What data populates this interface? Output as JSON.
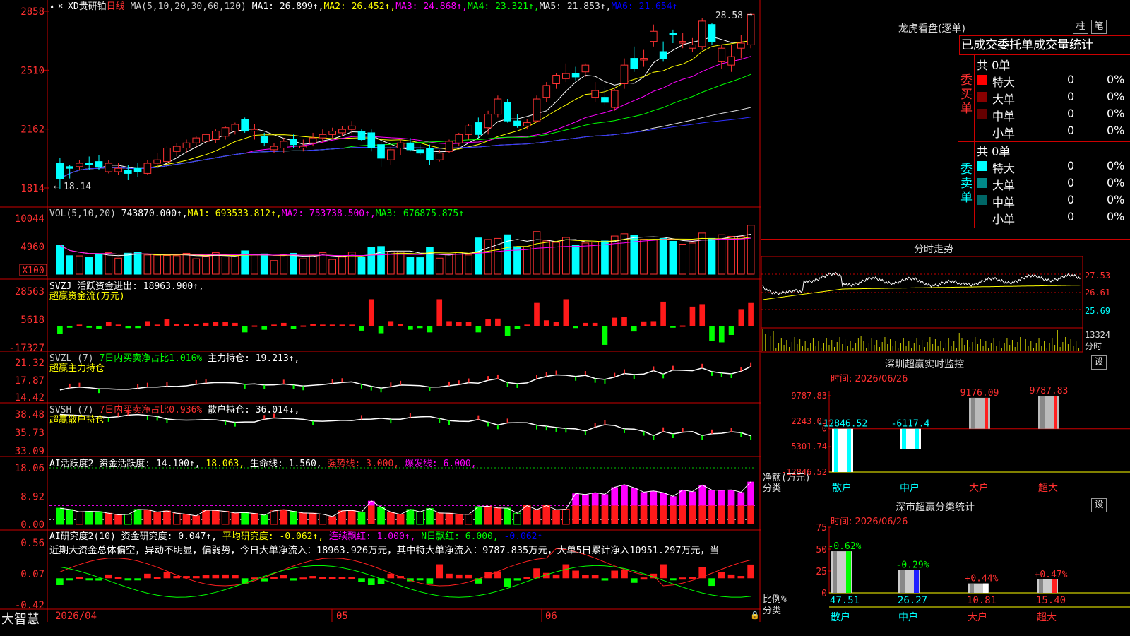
{
  "app": {
    "brand": "大智慧",
    "lock_glyph": "🔒"
  },
  "main_chart": {
    "stock": "XD贵研铂",
    "period": "日线",
    "ma_prefix": "MA(5,10,20,30,60,120)",
    "ma_values": [
      {
        "label": "MA1: 26.899↑",
        "color": "#ffffff"
      },
      {
        "label": "MA2: 26.452↑",
        "color": "#ffff00"
      },
      {
        "label": "MA3: 24.868↑",
        "color": "#ff00ff"
      },
      {
        "label": "MA4: 23.321↑",
        "color": "#00ff00"
      },
      {
        "label": "MA5: 21.853↑",
        "color": "#e0e0e0"
      },
      {
        "label": "MA6: 21.654↑",
        "color": "#0000ff"
      }
    ],
    "y_ticks": [
      "2858",
      "2510",
      "2162",
      "1814"
    ],
    "high_label": "28.58",
    "low_label": "18.14"
  },
  "vol_panel": {
    "header": [
      {
        "t": "VOL(5,10,20)",
        "c": "#cccccc"
      },
      {
        "t": " 743870.000↑,",
        "c": "#ffffff"
      },
      {
        "t": "MA1: 693533.812↑,",
        "c": "#ffff00"
      },
      {
        "t": "MA2: 753738.500↑,",
        "c": "#ff00ff"
      },
      {
        "t": "MA3: 676875.875↑",
        "c": "#00ff00"
      }
    ],
    "y_ticks": [
      "10044",
      "4960"
    ],
    "unit": "X100"
  },
  "svzj_panel": {
    "header": [
      {
        "t": "SVZJ  活跃资金进出: 18963.900↑,",
        "c": "#ffffff"
      }
    ],
    "subtitle": "超赢资金流(万元)",
    "y_ticks": [
      "28563",
      "5618",
      "-17327"
    ]
  },
  "svzl_panel": {
    "header": [
      {
        "t": "SVZL (7) ",
        "c": "#cccccc"
      },
      {
        "t": "7日内买卖净占比1.016%",
        "c": "#00ff00"
      },
      {
        "t": " 主力持仓: 19.213↑,",
        "c": "#ffffff"
      }
    ],
    "subtitle": "超赢主力持仓",
    "y_ticks": [
      "21.32",
      "17.87",
      "14.42"
    ]
  },
  "svsh_panel": {
    "header": [
      {
        "t": "SVSH (7) ",
        "c": "#cccccc"
      },
      {
        "t": "7日内买卖净占比0.936%",
        "c": "#ff3030"
      },
      {
        "t": " 散户持仓: 36.014↓,",
        "c": "#ffffff"
      }
    ],
    "subtitle": "超赢散户持仓",
    "y_ticks": [
      "38.48",
      "35.73",
      "33.09"
    ]
  },
  "ai_active_panel": {
    "header": [
      {
        "t": "AI活跃度2 资金活跃度: 14.100↑,",
        "c": "#ffffff"
      },
      {
        "t": " 18.063,",
        "c": "#ffff00"
      },
      {
        "t": " 生命线: 1.560,",
        "c": "#ffffff"
      },
      {
        "t": " 强势线: 3.000,",
        "c": "#ff3030"
      },
      {
        "t": " 爆发线: 6.000,",
        "c": "#ff00ff"
      }
    ],
    "y_ticks": [
      "18.06",
      "8.92",
      "0.00"
    ]
  },
  "ai_research_panel": {
    "header": [
      {
        "t": "AI研究度2(10) 资金研究度: 0.047↑,",
        "c": "#ffffff"
      },
      {
        "t": " 平均研究度: -0.062↑,",
        "c": "#ffff00"
      },
      {
        "t": " 连续飘红: 1.000↑,",
        "c": "#ff00ff"
      },
      {
        "t": " N日飘红: 6.000,",
        "c": "#00ff00"
      },
      {
        "t": " -0.062↑",
        "c": "#0000ff"
      }
    ],
    "commentary": "近期大资金总体偏空，异动不明显，偏弱势，今日大单净流入：18963.926万元，其中特大单净流入：9787.835万元，大单5日累计净入10951.297万元，当",
    "y_ticks": [
      "0.56",
      "0.07",
      "-0.42"
    ]
  },
  "date_axis": {
    "labels": [
      "2026/04",
      "05",
      "06"
    ]
  },
  "chart_data": {
    "type": "candlestick",
    "title": "XD贵研铂 日线",
    "ylim": [
      18.14,
      28.58
    ],
    "ohlc": [
      [
        19.6,
        19.9,
        18.1,
        18.7
      ],
      [
        19.4,
        19.5,
        18.7,
        19.3
      ],
      [
        19.4,
        19.8,
        19.2,
        19.6
      ],
      [
        19.6,
        20.0,
        19.2,
        19.5
      ],
      [
        19.7,
        20.1,
        19.2,
        19.4
      ],
      [
        19.1,
        19.8,
        19.0,
        19.6
      ],
      [
        19.1,
        19.6,
        18.9,
        19.3
      ],
      [
        19.2,
        19.5,
        18.6,
        19.0
      ],
      [
        19.3,
        19.6,
        18.8,
        19.1
      ],
      [
        19.0,
        19.8,
        18.9,
        19.6
      ],
      [
        19.6,
        20.2,
        19.5,
        19.8
      ],
      [
        19.7,
        20.6,
        19.6,
        20.5
      ],
      [
        20.3,
        20.8,
        20.0,
        20.6
      ],
      [
        20.5,
        21.0,
        20.2,
        20.8
      ],
      [
        20.8,
        21.2,
        20.5,
        21.1
      ],
      [
        20.9,
        21.4,
        20.7,
        21.3
      ],
      [
        21.0,
        21.6,
        20.8,
        21.5
      ],
      [
        21.2,
        21.8,
        21.0,
        21.7
      ],
      [
        21.5,
        22.0,
        21.3,
        21.9
      ],
      [
        22.2,
        22.3,
        21.4,
        21.5
      ],
      [
        21.5,
        21.9,
        21.0,
        21.6
      ],
      [
        21.2,
        21.4,
        20.6,
        20.8
      ],
      [
        20.4,
        20.8,
        20.2,
        20.6
      ],
      [
        20.5,
        21.1,
        20.2,
        20.9
      ],
      [
        21.0,
        21.3,
        20.5,
        20.7
      ],
      [
        20.5,
        21.0,
        20.3,
        20.6
      ],
      [
        20.8,
        21.4,
        20.6,
        21.1
      ],
      [
        21.1,
        21.6,
        20.8,
        21.3
      ],
      [
        21.3,
        21.7,
        21.1,
        21.5
      ],
      [
        21.4,
        21.8,
        21.2,
        21.6
      ],
      [
        21.6,
        22.1,
        21.3,
        21.8
      ],
      [
        21.5,
        21.6,
        20.9,
        21.0
      ],
      [
        21.4,
        21.6,
        20.3,
        20.5
      ],
      [
        20.7,
        21.1,
        19.4,
        19.9
      ],
      [
        19.8,
        20.6,
        19.5,
        20.4
      ],
      [
        20.5,
        21.0,
        20.1,
        20.8
      ],
      [
        20.8,
        21.1,
        20.3,
        20.4
      ],
      [
        20.4,
        20.7,
        20.1,
        20.2
      ],
      [
        20.5,
        20.7,
        19.5,
        19.8
      ],
      [
        19.8,
        20.4,
        19.7,
        20.2
      ],
      [
        20.3,
        21.0,
        20.2,
        20.9
      ],
      [
        20.8,
        21.4,
        20.6,
        21.3
      ],
      [
        21.3,
        21.9,
        21.0,
        21.8
      ],
      [
        22.0,
        22.3,
        21.1,
        21.3
      ],
      [
        21.7,
        22.7,
        21.3,
        22.5
      ],
      [
        22.5,
        23.6,
        22.3,
        23.4
      ],
      [
        23.2,
        23.4,
        22.0,
        22.1
      ],
      [
        22.1,
        22.5,
        21.7,
        21.8
      ],
      [
        21.8,
        22.2,
        21.6,
        22.0
      ],
      [
        22.1,
        23.6,
        22.0,
        23.4
      ],
      [
        23.5,
        24.4,
        23.2,
        24.2
      ],
      [
        24.3,
        24.9,
        24.0,
        24.8
      ],
      [
        24.6,
        25.5,
        24.4,
        24.9
      ],
      [
        24.9,
        25.3,
        24.5,
        24.7
      ],
      [
        25.0,
        25.5,
        24.7,
        25.4
      ],
      [
        23.5,
        24.4,
        23.2,
        23.9
      ],
      [
        23.5,
        24.1,
        23.0,
        23.2
      ],
      [
        22.9,
        24.0,
        22.7,
        23.9
      ],
      [
        24.3,
        25.8,
        24.0,
        25.4
      ],
      [
        25.8,
        26.5,
        25.0,
        25.2
      ],
      [
        25.7,
        26.3,
        25.3,
        25.8
      ],
      [
        26.8,
        27.8,
        26.5,
        27.4
      ],
      [
        26.2,
        26.8,
        25.6,
        25.8
      ],
      [
        27.3,
        27.5,
        26.7,
        27.2
      ],
      [
        26.7,
        27.3,
        26.4,
        26.8
      ],
      [
        26.4,
        27.0,
        26.2,
        26.6
      ],
      [
        26.5,
        28.2,
        26.3,
        28.0
      ],
      [
        27.8,
        27.9,
        26.6,
        26.8
      ],
      [
        25.6,
        26.6,
        25.2,
        26.4
      ],
      [
        25.4,
        26.6,
        25.0,
        25.9
      ],
      [
        26.4,
        27.2,
        25.8,
        26.7
      ],
      [
        26.6,
        28.5,
        26.4,
        28.4
      ]
    ],
    "series_names": [
      "MA1",
      "MA2",
      "MA3",
      "MA4",
      "MA5",
      "MA6"
    ],
    "volume_ylim": [
      0,
      10044
    ],
    "volume_y_ticks": [
      10044,
      4960
    ],
    "svzj_ylim": [
      -17327,
      28563
    ],
    "svzl_ylim": [
      14.42,
      21.32
    ],
    "svsh_ylim": [
      33.09,
      38.48
    ],
    "ai_active_ylim": [
      0,
      18.06
    ],
    "ai_research_ylim": [
      -0.42,
      0.56
    ]
  },
  "right_panel": {
    "longhu": {
      "title": "龙虎看盘(逐单)",
      "btn_zhu": "柱",
      "btn_bi": "笔",
      "tabs": "已成交委托单成交量统计",
      "buy": {
        "side_label": "委买单",
        "count": "共 0单",
        "rows": [
          {
            "name": "特大",
            "val": "0",
            "pct": "0%",
            "color": "#ff0000"
          },
          {
            "name": "大单",
            "val": "0",
            "pct": "0%",
            "color": "#880000"
          },
          {
            "name": "中单",
            "val": "0",
            "pct": "0%",
            "color": "#660000"
          },
          {
            "name": "小单",
            "val": "0",
            "pct": "0%",
            "color": ""
          }
        ]
      },
      "sell": {
        "side_label": "委卖单",
        "count": "共 0单",
        "rows": [
          {
            "name": "特大",
            "val": "0",
            "pct": "0%",
            "color": "#00ffff"
          },
          {
            "name": "大单",
            "val": "0",
            "pct": "0%",
            "color": "#008888"
          },
          {
            "name": "中单",
            "val": "0",
            "pct": "0%",
            "color": "#006666"
          },
          {
            "name": "小单",
            "val": "0",
            "pct": "0%",
            "color": ""
          }
        ]
      }
    },
    "intraday": {
      "title": "分时走势",
      "y_ticks": [
        "27.53",
        "26.61",
        "25.69"
      ],
      "vol_tick": "13324",
      "vol_label": "分时"
    },
    "shenzhen_monitor": {
      "title": "深圳超赢实时监控",
      "settings": "设",
      "time": "时间: 2026/06/26",
      "y_ticks": [
        "9787.83",
        "2243.05",
        "0",
        "-5301.74",
        "-12846.52"
      ],
      "ylabel": "净额(万元)",
      "xlabel": "分类",
      "categories": [
        "散户",
        "中户",
        "大户",
        "超大"
      ],
      "values": [
        -12846.52,
        -6117.4,
        9176.09,
        9787.83
      ],
      "value_labels": [
        "-12846.52",
        "-6117.4",
        "9176.09",
        "9787.83"
      ]
    },
    "shenzhen_class": {
      "title": "深市超赢分类统计",
      "settings": "设",
      "time": "时间: 2026/06/26",
      "y_ticks": [
        "75",
        "50",
        "25",
        "0"
      ],
      "ylabel": "比例%",
      "xlabel": "分类",
      "categories": [
        "散户",
        "中户",
        "大户",
        "超大"
      ],
      "values": [
        47.51,
        26.27,
        10.81,
        15.4
      ],
      "value_labels": [
        "47.51",
        "26.27",
        "10.81",
        "15.40"
      ],
      "change_labels": [
        "-0.62%",
        "-0.29%",
        "+0.44%",
        "+0.47%"
      ]
    }
  }
}
